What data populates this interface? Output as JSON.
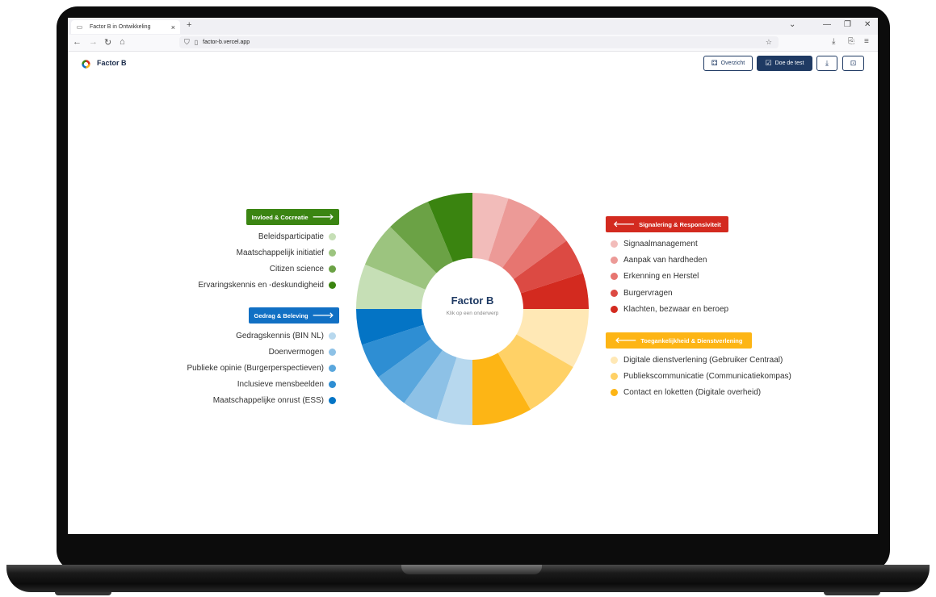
{
  "browser": {
    "tab_title": "Factor B in Ontwikkeling",
    "tab_close": "×",
    "new_tab": "+",
    "url": "factor-b.vercel.app"
  },
  "app": {
    "name": "Factor B",
    "buttons": {
      "overview": "Overzicht",
      "test": "Doe de test"
    }
  },
  "chart_center": {
    "title": "Factor B",
    "subtitle": "Klik op een onderwerp"
  },
  "chart_data": {
    "type": "pie",
    "donut": true,
    "start": "top, clockwise",
    "segments": [
      {
        "label": "Signaalmanagement",
        "value": 1,
        "color": "#F2BCBA"
      },
      {
        "label": "Aanpak van hardheden",
        "value": 1,
        "color": "#EC9A97"
      },
      {
        "label": "Erkenning en Herstel",
        "value": 1,
        "color": "#E77570"
      },
      {
        "label": "Burgervragen",
        "value": 1,
        "color": "#DC4A43"
      },
      {
        "label": "Klachten, bezwaar en beroep",
        "value": 1,
        "color": "#D32A1F"
      },
      {
        "label": "Digitale dienstverlening (Gebruiker Centraal)",
        "value": 1.667,
        "color": "#FFE8B5"
      },
      {
        "label": "Publiekscommunicatie (Communicatiekompas)",
        "value": 1.667,
        "color": "#FFD166"
      },
      {
        "label": "Contact en loketten (Digitale overheid)",
        "value": 1.667,
        "color": "#FDB515"
      },
      {
        "label": "Gedragskennis (BIN NL)",
        "value": 1,
        "color": "#B7D8EE"
      },
      {
        "label": "Doenvermogen",
        "value": 1,
        "color": "#8DC1E6"
      },
      {
        "label": "Publieke opinie (Burgerperspectieven)",
        "value": 1,
        "color": "#5AA7DD"
      },
      {
        "label": "Inclusieve mensbeelden",
        "value": 1,
        "color": "#2E8ED3"
      },
      {
        "label": "Maatschappelijke onrust (ESS)",
        "value": 1,
        "color": "#0474C5"
      },
      {
        "label": "Beleidsparticipatie",
        "value": 1.25,
        "color": "#C6DFB6"
      },
      {
        "label": "Maatschappelijk initiatief",
        "value": 1.25,
        "color": "#9CC47F"
      },
      {
        "label": "Citizen science",
        "value": 1.25,
        "color": "#6BA245"
      },
      {
        "label": "Ervaringskennis en -deskundigheid",
        "value": 1.25,
        "color": "#3A8410"
      }
    ]
  },
  "categories": {
    "invloed": {
      "label": "Invloed & Cocreatie",
      "arrow": "🡒",
      "color": "#3B8512",
      "items": [
        {
          "label": "Beleidsparticipatie",
          "color": "#C6DFB6"
        },
        {
          "label": "Maatschappelijk initiatief",
          "color": "#9CC47F"
        },
        {
          "label": "Citizen science",
          "color": "#6BA245"
        },
        {
          "label": "Ervaringskennis en -deskundigheid",
          "color": "#3A8410"
        }
      ]
    },
    "gedrag": {
      "label": "Gedrag & Beleving",
      "arrow": "🡒",
      "color": "#1170C4",
      "items": [
        {
          "label": "Gedragskennis (BIN NL)",
          "color": "#B7D8EE"
        },
        {
          "label": "Doenvermogen",
          "color": "#8DC1E6"
        },
        {
          "label": "Publieke opinie (Burgerperspectieven)",
          "color": "#5AA7DD"
        },
        {
          "label": "Inclusieve mensbeelden",
          "color": "#2E8ED3"
        },
        {
          "label": "Maatschappelijke onrust (ESS)",
          "color": "#0474C5"
        }
      ]
    },
    "signalering": {
      "label": "Signalering & Responsiviteit",
      "arrow": "🡐",
      "color": "#D32A1F",
      "items": [
        {
          "label": "Signaalmanagement",
          "color": "#F2BCBA"
        },
        {
          "label": "Aanpak van hardheden",
          "color": "#EC9A97"
        },
        {
          "label": "Erkenning en Herstel",
          "color": "#E77570"
        },
        {
          "label": "Burgervragen",
          "color": "#DC4A43"
        },
        {
          "label": "Klachten, bezwaar en beroep",
          "color": "#D32A1F"
        }
      ]
    },
    "toegankelijkheid": {
      "label": "Toegankelijkheid & Dienstverlening",
      "arrow": "🡐",
      "color": "#FDB515",
      "items": [
        {
          "label": "Digitale dienstverlening (Gebruiker Centraal)",
          "color": "#FFE8B5"
        },
        {
          "label": "Publiekscommunicatie (Communicatiekompas)",
          "color": "#FFD166"
        },
        {
          "label": "Contact en loketten (Digitale overheid)",
          "color": "#FDB515"
        }
      ]
    }
  }
}
